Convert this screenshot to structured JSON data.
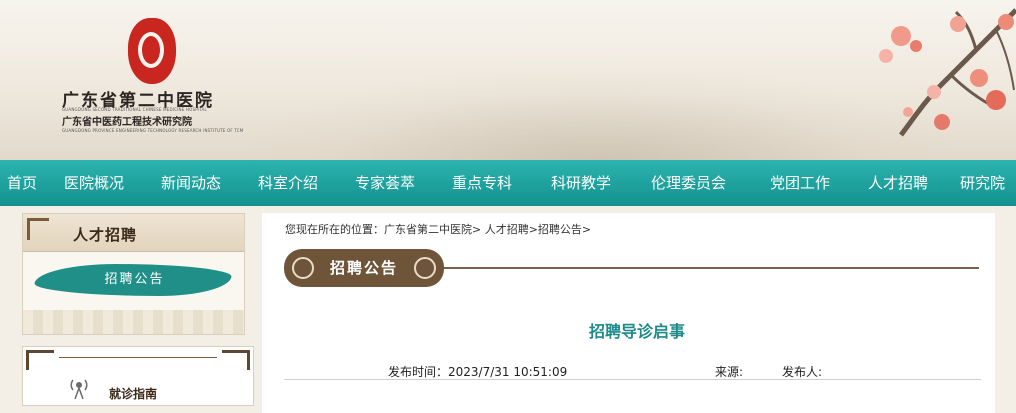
{
  "header": {
    "logo_title": "广东省第二中医院",
    "logo_en_line1": "GUANGDONG SECOND TRADITIONAL CHINESE MEDICINE HOSPITAL",
    "logo_subtitle": "广东省中医药工程技术研究院",
    "logo_en_line2": "GUANGDONG PROVINCE ENGINEERING TECHNOLOGY RESEARCH INSTITUTE OF TCM"
  },
  "nav": {
    "items": [
      {
        "label": "首页"
      },
      {
        "label": "医院概况"
      },
      {
        "label": "新闻动态"
      },
      {
        "label": "科室介绍"
      },
      {
        "label": "专家荟萃"
      },
      {
        "label": "重点专科"
      },
      {
        "label": "科研教学"
      },
      {
        "label": "伦理委员会"
      },
      {
        "label": "党团工作"
      },
      {
        "label": "人才招聘"
      },
      {
        "label": "研究院"
      }
    ]
  },
  "sidebar": {
    "title": "人才招聘",
    "items": [
      {
        "label": "招聘公告"
      }
    ],
    "guide_label": "就诊指南"
  },
  "main": {
    "breadcrumb": "您现在所在的位置：广东省第二中医院> 人才招聘>招聘公告>",
    "section_tab": "招聘公告",
    "article_title": "招聘导诊启事",
    "meta": {
      "publish_time": "发布时间：2023/7/31 10:51:09",
      "source": "来源:",
      "publisher": "发布人:"
    }
  },
  "colors": {
    "nav_teal": "#13918e",
    "title_teal": "#1e8a8a",
    "brown": "#6e5539",
    "seal_red": "#c8261e"
  }
}
